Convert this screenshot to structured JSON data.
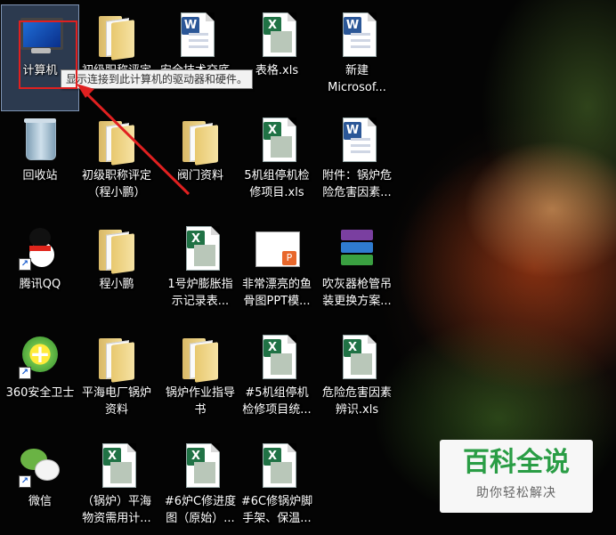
{
  "tooltip": {
    "text": "显示连接到此计算机的驱动器和硬件。"
  },
  "desktop": {
    "icons": [
      {
        "label": "计算机",
        "type": "computer"
      },
      {
        "label": "初级职称评定",
        "type": "folder"
      },
      {
        "label": "安全技术交底",
        "type": "word"
      },
      {
        "label": "表格.xls",
        "type": "excel"
      },
      {
        "label": "新建\nMicrosof...",
        "type": "word"
      },
      {
        "label": "回收站",
        "type": "recycle-bin"
      },
      {
        "label": "初级职称评定\n（程小鹏）",
        "type": "folder"
      },
      {
        "label": "阀门资料",
        "type": "folder"
      },
      {
        "label": "5机组停机检\n修项目.xls",
        "type": "excel"
      },
      {
        "label": "附件：锅炉危\n险危害因素...",
        "type": "word"
      },
      {
        "label": "腾讯QQ",
        "type": "qq"
      },
      {
        "label": "程小鹏",
        "type": "folder"
      },
      {
        "label": "1号炉膨胀指\n示记录表...",
        "type": "excel"
      },
      {
        "label": "非常漂亮的鱼\n骨图PPT模...",
        "type": "ppt-image"
      },
      {
        "label": "吹灰器枪管吊\n装更换方案...",
        "type": "winrar"
      },
      {
        "label": "360安全卫士",
        "type": "360"
      },
      {
        "label": "平海电厂锅炉\n资料",
        "type": "folder"
      },
      {
        "label": "锅炉作业指导\n书",
        "type": "folder"
      },
      {
        "label": "#5机组停机\n检修项目统...",
        "type": "excel"
      },
      {
        "label": "危险危害因素\n辨识.xls",
        "type": "excel"
      },
      {
        "label": "微信",
        "type": "wechat"
      },
      {
        "label": "（锅炉）平海\n物资需用计...",
        "type": "excel"
      },
      {
        "label": "#6炉C修进度\n图（原始）...",
        "type": "excel"
      },
      {
        "label": "#6C修锅炉脚\n手架、保温...",
        "type": "excel"
      }
    ]
  },
  "watermark": {
    "title": "百科全说",
    "subtitle": "助你轻松解决"
  },
  "colors": {
    "annotation": "#e02020",
    "watermark_green": "#2a9d45",
    "selection": "#78a0dc"
  }
}
